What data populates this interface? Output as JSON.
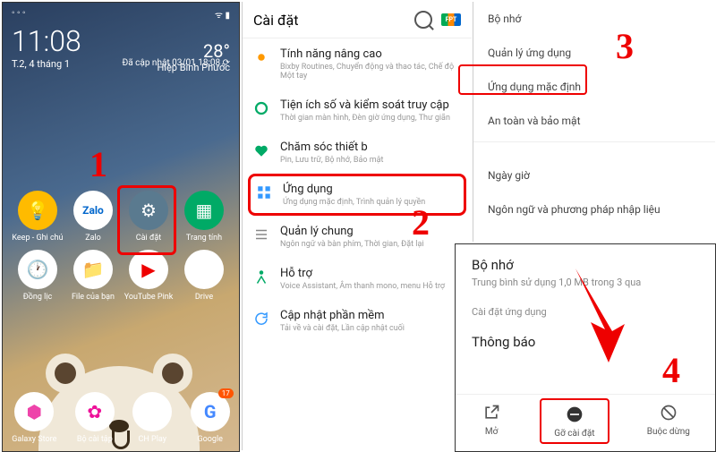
{
  "panel1": {
    "time": "11:08",
    "day": "T.2, 4 tháng 1",
    "temp": "28°",
    "location": "Hiệp Bình Phước",
    "updated": "Đã cập nhật 03/01 18:08 ⟳",
    "apps_row1": [
      {
        "label": "Keep - Ghi chú",
        "color": "#fb0"
      },
      {
        "label": "Zalo",
        "color": "#fff"
      },
      {
        "label": "Cài đặt",
        "color": "#5a7a8f"
      },
      {
        "label": "Trang tính",
        "color": "#0a6"
      }
    ],
    "apps_row2": [
      {
        "label": "Đồng lịc",
        "color": "#fff"
      },
      {
        "label": "File của bạn",
        "color": "#fff"
      },
      {
        "label": "YouTube Pink",
        "color": "#fff"
      },
      {
        "label": "Drive",
        "color": "#fff"
      }
    ],
    "dock": [
      {
        "label": "Galaxy Store",
        "color": "#fff",
        "badge": ""
      },
      {
        "label": "Bộ cài tập",
        "color": "#fff",
        "badge": ""
      },
      {
        "label": "CH Play",
        "color": "#fff",
        "badge": ""
      },
      {
        "label": "Google",
        "color": "#fff",
        "badge": "17"
      }
    ]
  },
  "panel2": {
    "title": "Cài đặt",
    "items": [
      {
        "title": "Tính năng nâng cao",
        "sub": "Bixby Routines, Chuyển động và thao tác, Chế độ Một tay",
        "icon": "#f90"
      },
      {
        "title": "Tiện ích số và kiểm soát truy cập",
        "sub": "Thời gian màn hình, Đèn giờ ứng dụng, Thư giãn",
        "icon": "#0a6"
      },
      {
        "title": "Chăm sóc thiết b",
        "sub": "Pin, Lưu trữ, Bộ nhớ, Bảo mật",
        "icon": "#0a6"
      },
      {
        "title": "Ứng dụng",
        "sub": "Ứng dụng mặc định, Trình quản lý quyền",
        "icon": "#39f"
      },
      {
        "title": "Quản lý chung",
        "sub": "Ngôn ngữ và bàn phím, Thời gian, Đặt lại",
        "icon": "#888"
      },
      {
        "title": "Hỗ trợ",
        "sub": "Voice Assistant, Âm thanh mono, menu Hỗ trợ",
        "icon": "#0a6"
      },
      {
        "title": "Cập nhật phần mềm",
        "sub": "Tải về và cài đặt, Lần cập nhật cuối",
        "icon": "#39f"
      }
    ]
  },
  "panel3": {
    "items": [
      "Bộ nhớ",
      "Quản lý ứng dụng",
      "Ứng dụng mặc định",
      "An toàn và bảo mật",
      "",
      "Ngày giờ",
      "Ngôn ngữ và phương pháp nhập liệu"
    ]
  },
  "panel4": {
    "title": "Bộ nhớ",
    "sub": "Trung bình sử dụng 1,0 MB trong 3    qua",
    "section": "Cài đặt ứng dụng",
    "section2": "Thông báo",
    "buttons": [
      {
        "label": "Mở"
      },
      {
        "label": "Gỡ cài đặt"
      },
      {
        "label": "Buộc dừng"
      }
    ]
  },
  "steps": {
    "s1": "1",
    "s2": "2",
    "s3": "3",
    "s4": "4"
  }
}
